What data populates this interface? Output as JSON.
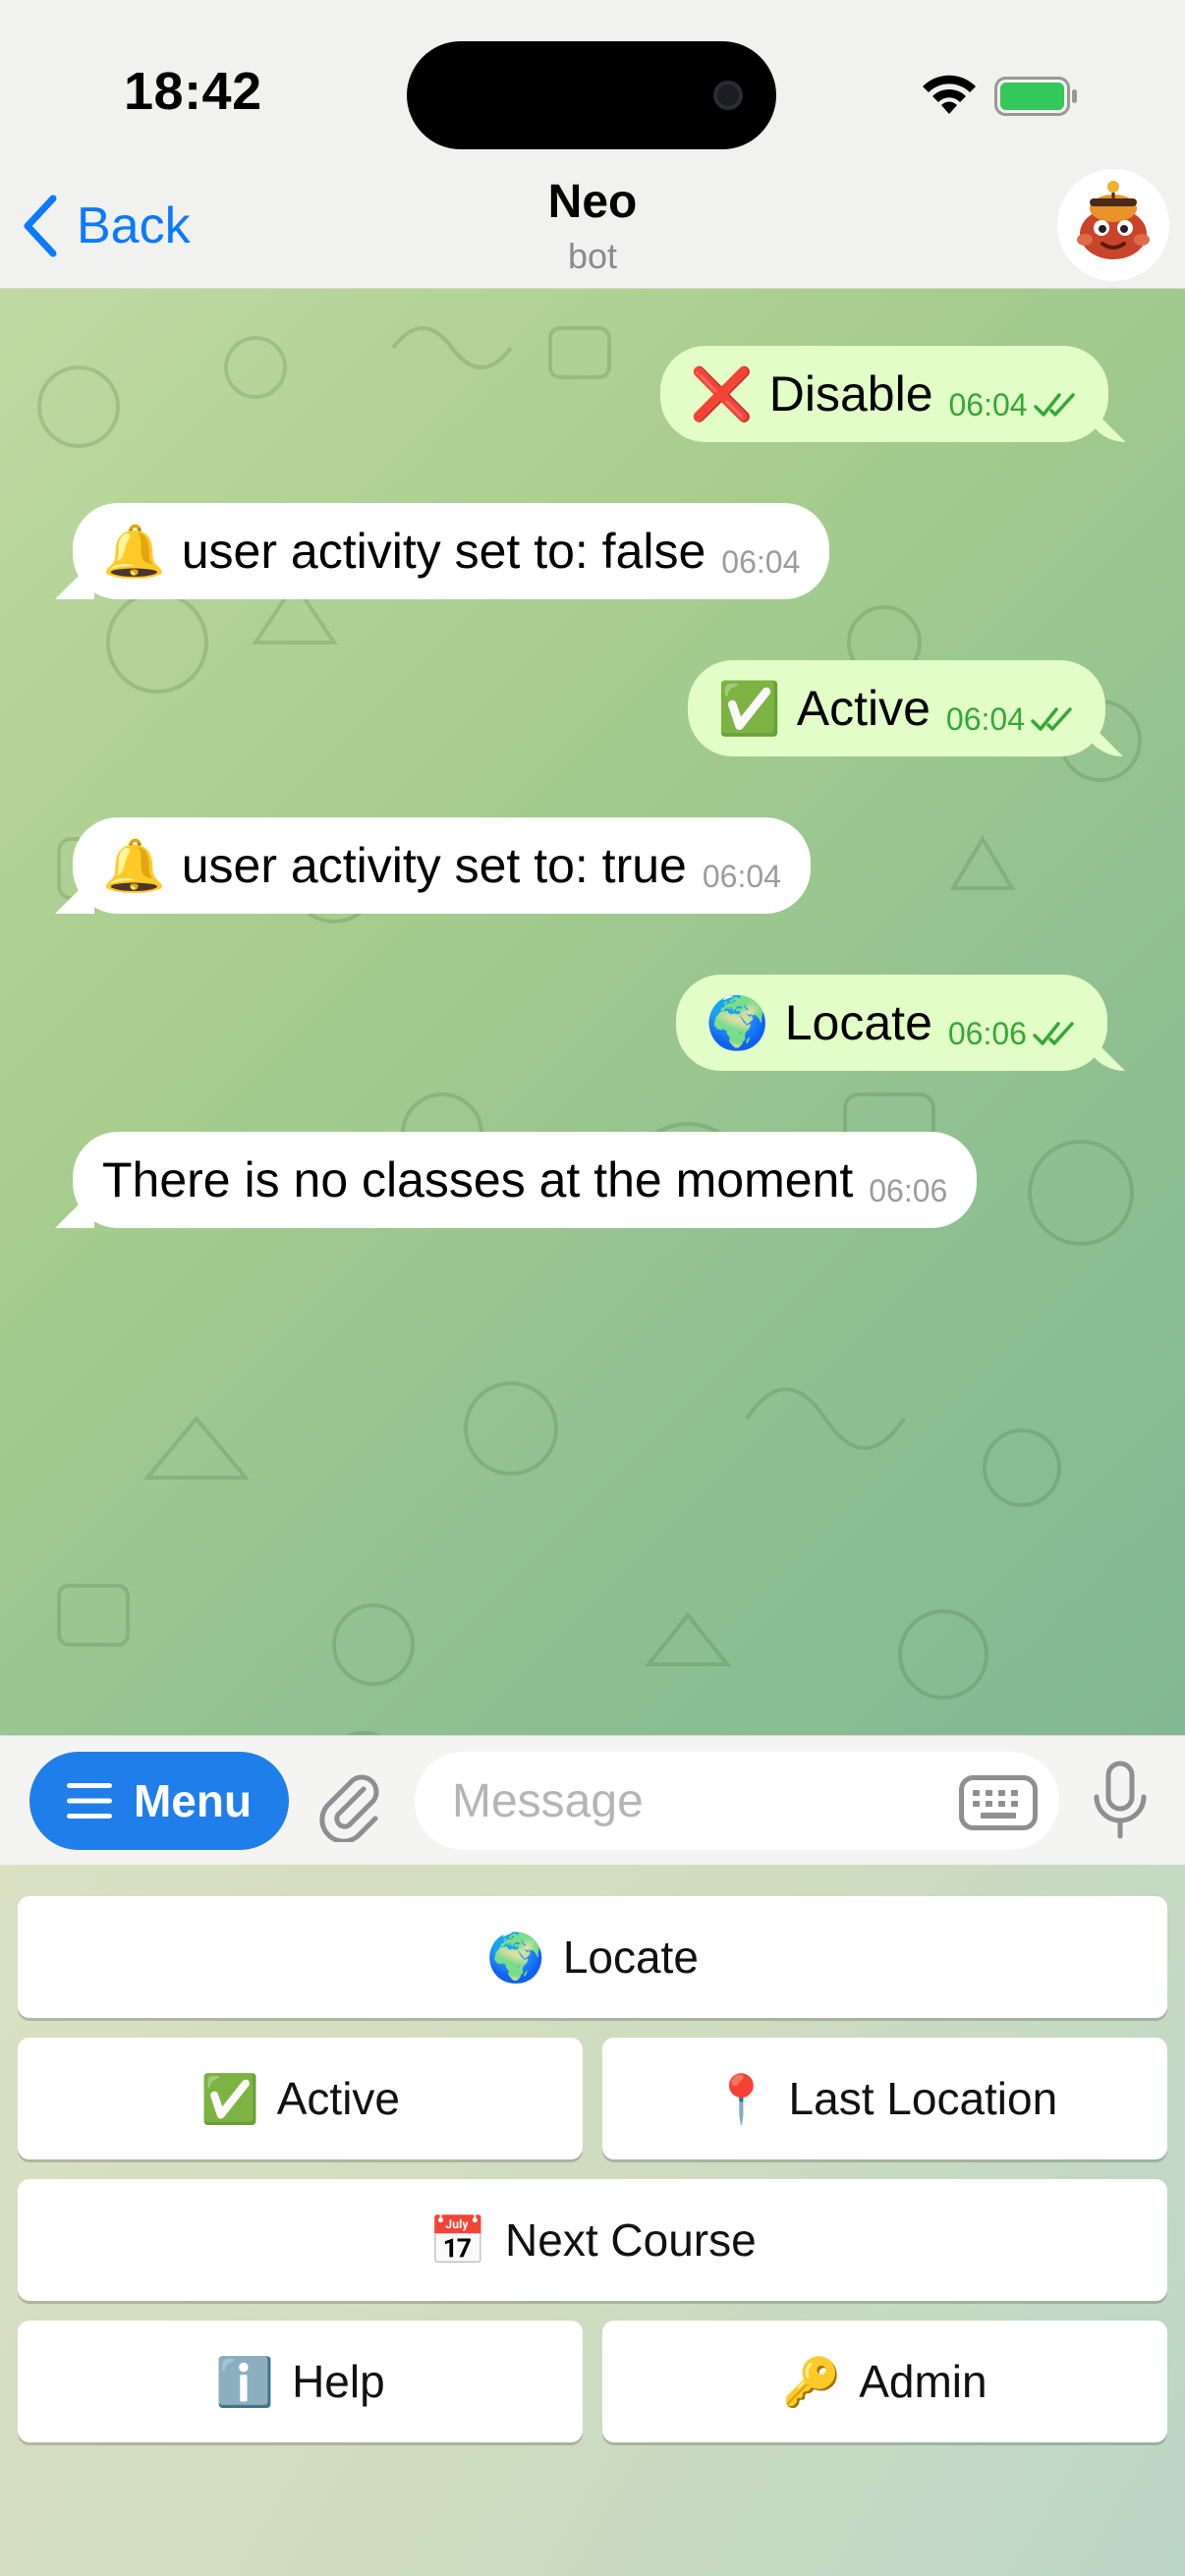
{
  "status_bar": {
    "time": "18:42",
    "wifi_icon": "wifi-icon",
    "battery_icon": "battery-icon"
  },
  "nav": {
    "back_label": "Back",
    "title": "Neo",
    "subtitle": "bot",
    "avatar_icon": "bot-avatar"
  },
  "messages": [
    {
      "direction": "out",
      "emoji": "❌",
      "text": "Disable",
      "time": "06:04",
      "read": true
    },
    {
      "direction": "in",
      "emoji": "🔔",
      "text": "user activity set to: false",
      "time": "06:04"
    },
    {
      "direction": "out",
      "emoji": "✅",
      "text": "Active",
      "time": "06:04",
      "read": true
    },
    {
      "direction": "in",
      "emoji": "🔔",
      "text": "user activity set to: true",
      "time": "06:04"
    },
    {
      "direction": "out",
      "emoji": "🌍",
      "text": "Locate",
      "time": "06:06",
      "read": true
    },
    {
      "direction": "in",
      "emoji": "",
      "text": "There is no classes at the moment",
      "time": "06:06"
    }
  ],
  "composer": {
    "menu_label": "Menu",
    "placeholder": "Message",
    "value": ""
  },
  "bot_keyboard": [
    {
      "emoji": "🌍",
      "label": "Locate"
    },
    {
      "emoji": "✅",
      "label": "Active"
    },
    {
      "emoji": "📍",
      "label": "Last Location"
    },
    {
      "emoji": "📅",
      "label": "Next Course"
    },
    {
      "emoji": "ℹ️",
      "label": "Help"
    },
    {
      "emoji": "🔑",
      "label": "Admin"
    }
  ],
  "colors": {
    "accent": "#0a7aff",
    "menu_button": "#1f7eea",
    "outgoing_bubble": "#e2fdc7",
    "incoming_bubble": "#ffffff",
    "outgoing_time": "#35a838"
  }
}
